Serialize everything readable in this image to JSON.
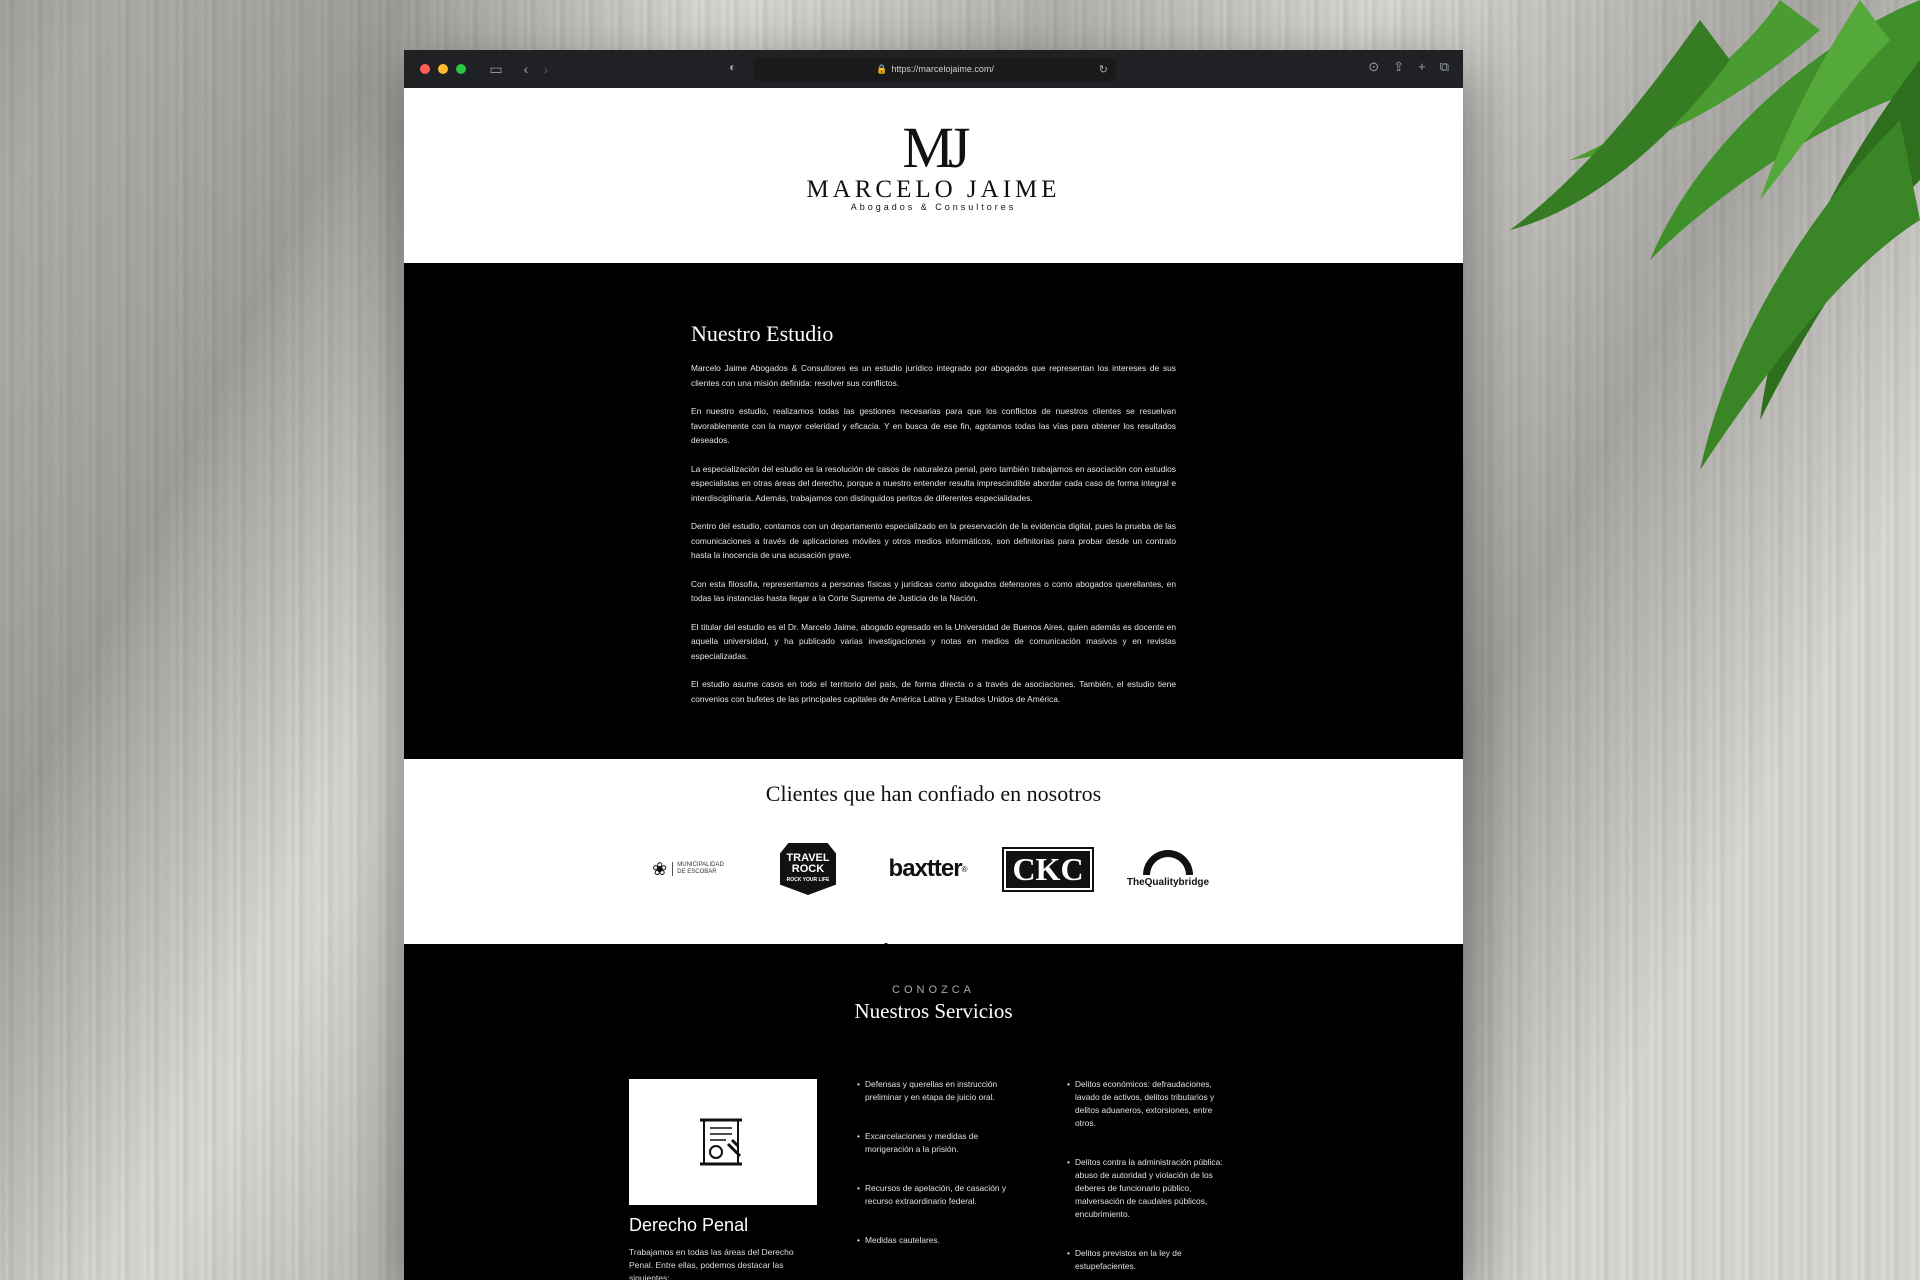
{
  "browser": {
    "url": "https://marcelojaime.com/",
    "lights": [
      "#ff5f57",
      "#febc2e",
      "#28c840"
    ]
  },
  "logo": {
    "monogram": "MJ",
    "name": "MARCELO JAIME",
    "subtitle": "Abogados & Consultores"
  },
  "estudio": {
    "title": "Nuestro Estudio",
    "paragraphs": [
      "Marcelo Jaime Abogados & Consultores es un estudio jurídico integrado por abogados que representan los intereses de sus clientes con una misión definida: resolver sus conflictos.",
      "En nuestro estudio, realizamos todas las gestiones necesarias para que los conflictos de nuestros clientes se resuelvan favorablemente con la mayor celeridad y eficacia. Y en busca de ese fin, agotamos todas las vías para obtener los resultados deseados.",
      "La especialización del estudio es la resolución de casos de naturaleza penal, pero también trabajamos en asociación con estudios especialistas en otras áreas del derecho, porque a nuestro entender resulta imprescindible abordar cada caso de forma integral e interdisciplinaria. Además, trabajamos con distinguidos peritos de diferentes especialidades.",
      "Dentro del estudio, contamos con un departamento especializado en la preservación de la evidencia digital, pues la prueba de las comunicaciones a través de aplicaciones móviles y otros medios informáticos, son definitorias para probar desde un contrato hasta la inocencia de una acusación grave.",
      "Con esta filosofía, representamos a personas físicas y jurídicas como abogados defensores o como abogados querellantes, en todas las instancias hasta llegar a la Corte Suprema de Justicia de la Nación.",
      "El titular del estudio es el Dr. Marcelo Jaime, abogado egresado en la Universidad de Buenos Aires, quien además es docente en aquella universidad, y ha publicado varias investigaciones y notas en medios de comunicación masivos y en revistas especializadas.",
      "El estudio asume casos en todo el territorio del país, de forma directa o a través de asociaciones. También, el estudio tiene convenios con bufetes de las principales capitales de América Latina y Estados Unidos de América."
    ]
  },
  "clientes": {
    "title": "Clientes que han confiado en nosotros",
    "escobar": {
      "line1": "MUNICIPALIDAD",
      "line2": "DE ESCOBAR"
    },
    "travel": {
      "line1": "TRAVEL",
      "line2": "ROCK",
      "tagline": "ROCK YOUR LIFE"
    },
    "baxtter": "baxtter",
    "ckc": "CKC",
    "quality": "TheQualitybridge"
  },
  "servicios": {
    "kicker": "CONOZCA",
    "title": "Nuestros Servicios",
    "card_title": "Derecho Penal",
    "card_desc": "Trabajamos en todas las áreas del Derecho Penal. Entre ellas, podemos destacar las siguientes:",
    "list1": [
      "Defensas y querellas en instrucción preliminar y en etapa de juicio oral.",
      "Excarcelaciones y medidas de morigeración a la prisión.",
      "Recursos de apelación, de casación y recurso extraordinario federal.",
      "Medidas cautelares."
    ],
    "list2": [
      "Delitos económicos: defraudaciones, lavado de activos, delitos tributarios y delitos aduaneros, extorsiones, entre otros.",
      "Delitos contra la administración pública: abuso de autoridad y violación de los deberes de funcionario público, malversación de caudales públicos, encubrimiento.",
      "Delitos previstos en la ley de estupefacientes."
    ]
  }
}
